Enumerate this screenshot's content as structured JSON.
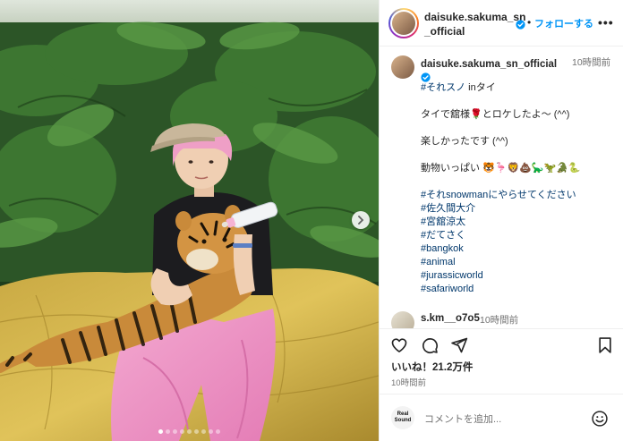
{
  "post": {
    "username": "daisuke.sakuma_sn_official",
    "follow_label": "フォローする",
    "bullet": "•",
    "more_label": "•••"
  },
  "caption": {
    "username": "daisuke.sakuma_sn_official",
    "time": "10時間前",
    "lines": [
      {
        "text": "#それスノ",
        "suffix": " inタイ"
      },
      {
        "text": ""
      },
      {
        "text": "タイで舘様🌹とロケしたよ〜 (^^)"
      },
      {
        "text": ""
      },
      {
        "text": "楽しかったです (^^)"
      },
      {
        "text": ""
      },
      {
        "text": "動物いっぱい 🐯🦩🦁💩🦕🦖🐊🐍"
      },
      {
        "text": ""
      }
    ],
    "hashtags": [
      "#それsnowmanにやらせてください",
      "#佐久間大介",
      "#宮舘涼太",
      "#だてさく",
      "#bangkok",
      "#animal",
      "#jurassicworld",
      "#safariworld"
    ]
  },
  "comment": {
    "username": "s.km__o7o5",
    "time": "10時間前"
  },
  "stats": {
    "likes": "いいね！21.2万件",
    "posted": "10時間前"
  },
  "comment_box": {
    "placeholder": "コメントを追加...",
    "logo_line1": "Real",
    "logo_line2": "Sound"
  },
  "carousel": {
    "slide_count": 9,
    "active_index": 0
  },
  "colors": {
    "link": "#0095f6",
    "hashtag": "#00376b",
    "muted": "#737373",
    "verified": "#0095f6"
  }
}
